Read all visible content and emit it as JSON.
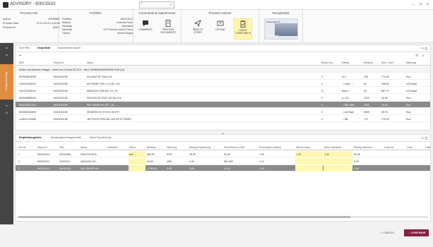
{
  "app": {
    "title": "ADVISORY - 600215/10",
    "search_value": "*",
    "window_controls": "– ↗ ×"
  },
  "process_info": {
    "heading": "Process Info",
    "rows": [
      {
        "k": "Author",
        "v": "at%98861"
      },
      {
        "k": "Process Start",
        "v": "19.11.2018 14:03:04"
      },
      {
        "k": "Process ID",
        "v": "64871"
      }
    ]
  },
  "portfolio": {
    "heading": "Portfolio",
    "rows": [
      {
        "k": "Portfolio",
        "v": "600215/10"
      },
      {
        "k": "Advisor",
        "v": "Antonia Florin"
      },
      {
        "k": "Strategy",
        "v": "Specialist"
      },
      {
        "k": "Mandate",
        "v": "VV Premium direct Fokus"
      },
      {
        "k": "Owner",
        "v": "Moritz Brugel"
      }
    ]
  },
  "comments": {
    "heading": "Comments & Attachments",
    "tools": [
      {
        "label": "COMMENTS",
        "icon": "comment-icon"
      },
      {
        "label": "PROCESS DOCUMENTS",
        "icon": "document-icon"
      }
    ]
  },
  "process_actions": {
    "heading": "Process Actions",
    "tools": [
      {
        "label": "SEND TO OTHER",
        "icon": "send-icon"
      },
      {
        "label": "UPLOAD",
        "icon": "upload-icon"
      },
      {
        "label": "CHECK COMPLIANCE",
        "icon": "clipboard-check-icon"
      }
    ]
  },
  "recipients": {
    "heading": "Recipient(s)",
    "chip": "advisor@f2-6C",
    "name": "Moritz Brugel"
  },
  "leftnav": {
    "items": [
      "A",
      "A",
      "A",
      "A"
    ],
    "active": "Anlagevorschlag"
  },
  "positions": {
    "tabs": [
      "Sort Pills",
      "Depotliste",
      "Instruments search"
    ],
    "active_tab": "Depotliste",
    "columns": [
      "ISIN",
      "Depot Nr",
      "Name",
      "Risiko Lev...",
      "Rating",
      "Bestand",
      "Kurs / Wert",
      "Währung"
    ],
    "group_label": "Aktien und ähnliche Anlagen - Anteil am Portfolio 80.32% - Wert 1592808.6099999999 EUR (14)",
    "rows": [
      [
        "DE0008404005",
        "600215/1050",
        "ALLIANZ SE VNA O.N.",
        "C",
        "A2 / -",
        "220",
        "174.45",
        "Euro"
      ],
      [
        "US0231351067",
        "600215/1050",
        "ALPHABET INC.CL.A DL-,001",
        "C",
        "- / AAA / ...",
        "62",
        "958.62",
        "US-Dollar"
      ],
      [
        "US0231351067",
        "600215/1050",
        "AMAZON.COM INC. DL-,01",
        "D",
        "Baa1 / -",
        "40",
        "887.71",
        "US-Dollar"
      ],
      [
        "DE0005552004",
        "600215/1050",
        "DEUTSCHE POST AG NA O.N.",
        "C",
        "A / A2 / -",
        "1133",
        "32.38",
        "Euro"
      ],
      [
        "NL0011821202",
        "600215/1050",
        "ING GROEP NV EO -,01",
        "C",
        "- / BB / BA2",
        "2760",
        "15.14",
        "Euro"
      ],
      [
        "IE00B53SZB19",
        "600215/1050",
        "ISHARES EU STOXX 50 ETF",
        "C",
        "- / AA High",
        "#500",
        "35.76",
        "Euro"
      ],
      [
        "LU0011700085",
        "600215/1050",
        "JB FOCUS SPECIAL UNI UR R FONDS",
        "C",
        "- / BB",
        "170",
        "175.49",
        "Euro"
      ]
    ],
    "selected_row": 4
  },
  "orders": {
    "tabs": [
      "Empfehlungsliste",
      "Beratungsnnewsgeschäft",
      "Nicht Empfehlung"
    ],
    "active_tab": "Empfehlungsliste",
    "columns": [
      "Lfd. Nr",
      "Depot Nr",
      "ISIN",
      "Name",
      "Zielmarkt",
      "Aktion",
      "Bestand",
      "Währung",
      "Betrag Empfehlung",
      "Preis/Stück in EUR",
      "Devisenkurs (Markt)",
      "Stücke empf...",
      "Stück Interesse",
      "Betrag Interesse",
      "Limit-Art",
      "Limit",
      "Limit"
    ],
    "rows": [
      [
        "1",
        "600215/10...",
        "DE000081...",
        "DEUTSCHE B...",
        "",
        "sell",
        "880.00",
        "EUR",
        "95.38",
        "95.38",
        "1.00",
        "1.00",
        "1.00",
        "95.38",
        "",
        "",
        ""
      ],
      [
        "2",
        "600215/10...",
        "US02313...",
        "AMAZON.CO...",
        "",
        "",
        "40.00",
        "USD",
        "0.00",
        "881.695",
        "1.12",
        "",
        "",
        "0.00",
        "",
        "",
        ""
      ],
      [
        "3",
        "600215/10...",
        "NL001182...",
        "ING GROEP NV...",
        "",
        "",
        "2,760.00",
        "EUR",
        "0.00",
        "15.14",
        "1.00",
        "",
        "",
        "0.00",
        "",
        "",
        ""
      ]
    ],
    "selected_row": 2
  },
  "footer": {
    "cancel": "CANCEL",
    "continue": "CONTINUE"
  },
  "colors": {
    "accent": "#8b1e3f",
    "nav_active": "#e08d3f",
    "highlight": "#fff7b0"
  }
}
